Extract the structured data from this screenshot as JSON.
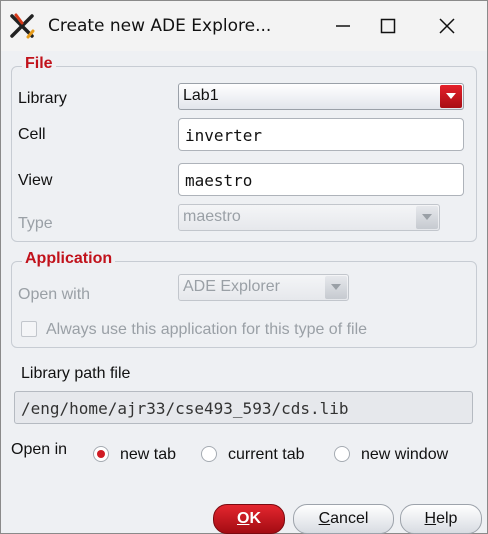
{
  "window": {
    "title": "Create new ADE Explore..."
  },
  "file_group": {
    "title": "File",
    "library_label": "Library",
    "library_value": "Lab1",
    "cell_label": "Cell",
    "cell_value": "inverter",
    "view_label": "View",
    "view_value": "maestro",
    "type_label": "Type",
    "type_value": "maestro"
  },
  "application_group": {
    "title": "Application",
    "open_with_label": "Open with",
    "open_with_value": "ADE Explorer",
    "always_use_label": "Always use this application for this type of file",
    "always_use_checked": false
  },
  "library_path": {
    "label": "Library path file",
    "value": "/eng/home/ajr33/cse493_593/cds.lib"
  },
  "open_in": {
    "label": "Open in",
    "options": [
      "new tab",
      "current tab",
      "new window"
    ],
    "selected": "new tab"
  },
  "buttons": {
    "ok_mnemonic": "O",
    "ok_rest": "K",
    "cancel_mnemonic": "C",
    "cancel_rest": "ancel",
    "help_mnemonic": "H",
    "help_rest": "elp"
  },
  "colors": {
    "accent": "#c1121b",
    "background": "#eef0f3"
  }
}
